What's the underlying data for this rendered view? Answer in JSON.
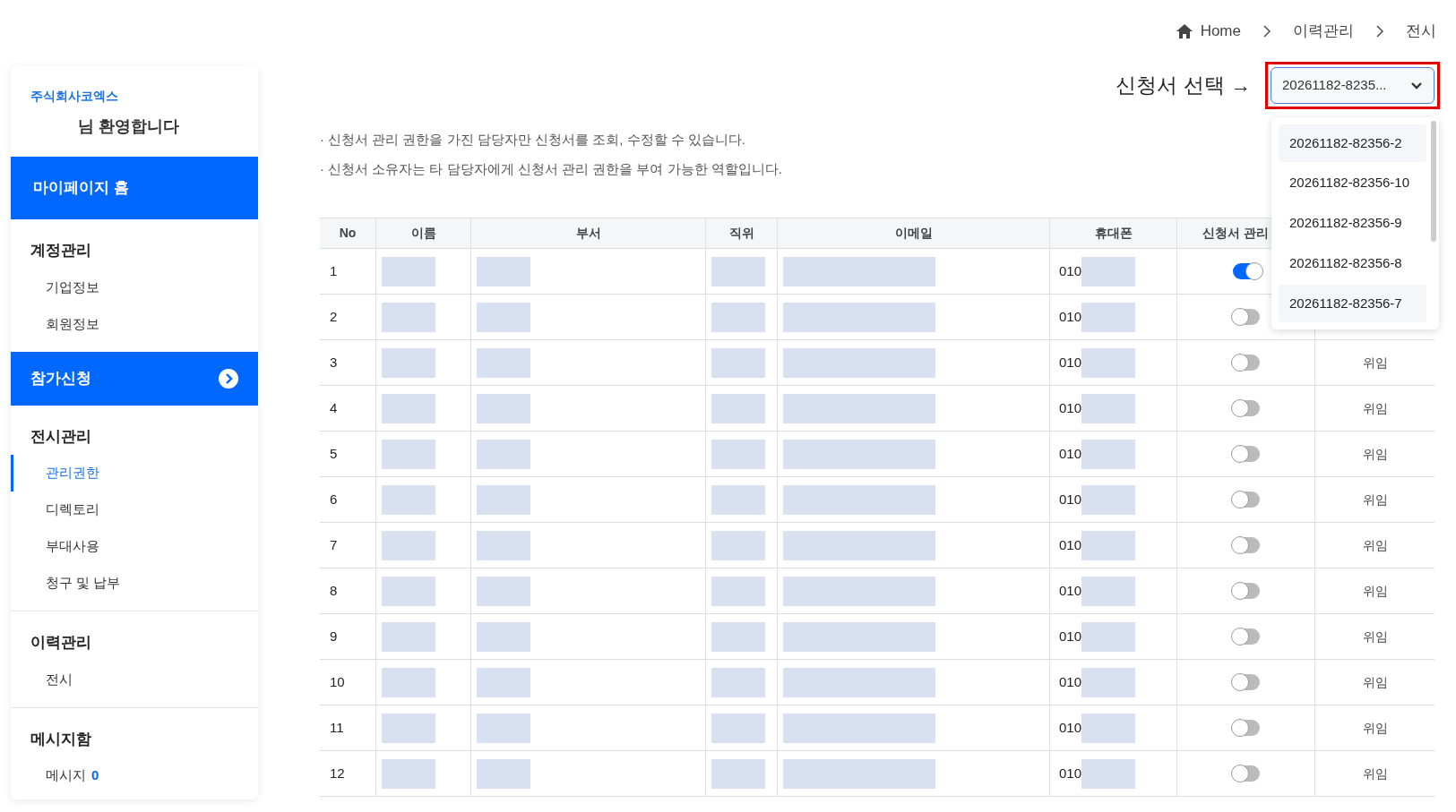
{
  "breadcrumb": [
    "Home",
    "이력관리",
    "전시"
  ],
  "sidebar": {
    "company": "주식회사코엑스",
    "welcome": "님 환영합니다",
    "sections": [
      {
        "kind": "banner",
        "title": "마이페이지 홈",
        "arrow": false
      },
      {
        "kind": "group",
        "title": "계정관리",
        "items": [
          {
            "label": "기업정보",
            "selected": false
          },
          {
            "label": "회원정보",
            "selected": false
          }
        ]
      },
      {
        "kind": "banner",
        "title": "참가신청",
        "arrow": true
      },
      {
        "kind": "group",
        "title": "전시관리",
        "items": [
          {
            "label": "관리권한",
            "selected": true
          },
          {
            "label": "디렉토리",
            "selected": false
          },
          {
            "label": "부대사용",
            "selected": false
          },
          {
            "label": "청구 및 납부",
            "selected": false
          }
        ]
      },
      {
        "kind": "group",
        "title": "이력관리",
        "items": [
          {
            "label": "전시",
            "selected": false
          }
        ]
      },
      {
        "kind": "group",
        "title": "메시지함",
        "items": [
          {
            "label": "메시지",
            "selected": false,
            "count": "0"
          }
        ]
      }
    ]
  },
  "selector": {
    "label": "신청서 선택 →",
    "value": "20261182-8235...",
    "expanded": true,
    "options": [
      {
        "label": "20261182-82356-2",
        "highlighted": true
      },
      {
        "label": "20261182-82356-10",
        "highlighted": false
      },
      {
        "label": "20261182-82356-9",
        "highlighted": false
      },
      {
        "label": "20261182-82356-8",
        "highlighted": false
      },
      {
        "label": "20261182-82356-7",
        "highlighted": true
      }
    ]
  },
  "notices": [
    "· 신청서 관리 권한을 가진 담당자만 신청서를 조회, 수정할 수 있습니다.",
    "· 신청서 소유자는 타 담당자에게 신청서 관리 권한을 부여 가능한 역할입니다."
  ],
  "table": {
    "columns": [
      "No",
      "이름",
      "부서",
      "직위",
      "이메일",
      "휴대폰",
      "신청서 관리"
    ],
    "rows": [
      {
        "no": "1",
        "phone": "010",
        "on": true
      },
      {
        "no": "2",
        "phone": "010",
        "on": false
      },
      {
        "no": "3",
        "phone": "010",
        "on": false,
        "action": "위임"
      },
      {
        "no": "4",
        "phone": "010",
        "on": false,
        "action": "위임"
      },
      {
        "no": "5",
        "phone": "010",
        "on": false,
        "action": "위임"
      },
      {
        "no": "6",
        "phone": "010",
        "on": false,
        "action": "위임"
      },
      {
        "no": "7",
        "phone": "010",
        "on": false,
        "action": "위임"
      },
      {
        "no": "8",
        "phone": "010",
        "on": false,
        "action": "위임"
      },
      {
        "no": "9",
        "phone": "010",
        "on": false,
        "action": "위임"
      },
      {
        "no": "10",
        "phone": "010",
        "on": false,
        "action": "위임"
      },
      {
        "no": "11",
        "phone": "010",
        "on": false,
        "action": "위임"
      },
      {
        "no": "12",
        "phone": "010",
        "on": false,
        "action": "위임"
      }
    ]
  }
}
